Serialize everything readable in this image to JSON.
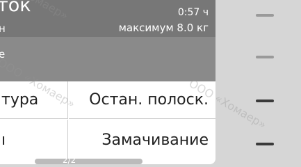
{
  "header": {
    "title": "ток",
    "subtitle": "н",
    "time": "0:57 ч",
    "max_load": "максимум 8.0 кг"
  },
  "subheader": {
    "text": "е"
  },
  "options": [
    {
      "label": "тура"
    },
    {
      "label": "Остан. полоск."
    },
    {
      "label": "ı"
    },
    {
      "label": "Замачивание"
    }
  ],
  "pager": {
    "indicator": "2/2"
  },
  "side_indicators": [
    "inactive",
    "inactive",
    "active",
    "active"
  ],
  "watermark": {
    "text1": "ООО «Хомаер»",
    "text2": "«Хомаер»"
  },
  "colors": {
    "header_bg": "#777777",
    "subheader_bg": "#8a8a8a",
    "panel_bg": "#ffffff",
    "screen_bg": "#d6d6d6"
  }
}
